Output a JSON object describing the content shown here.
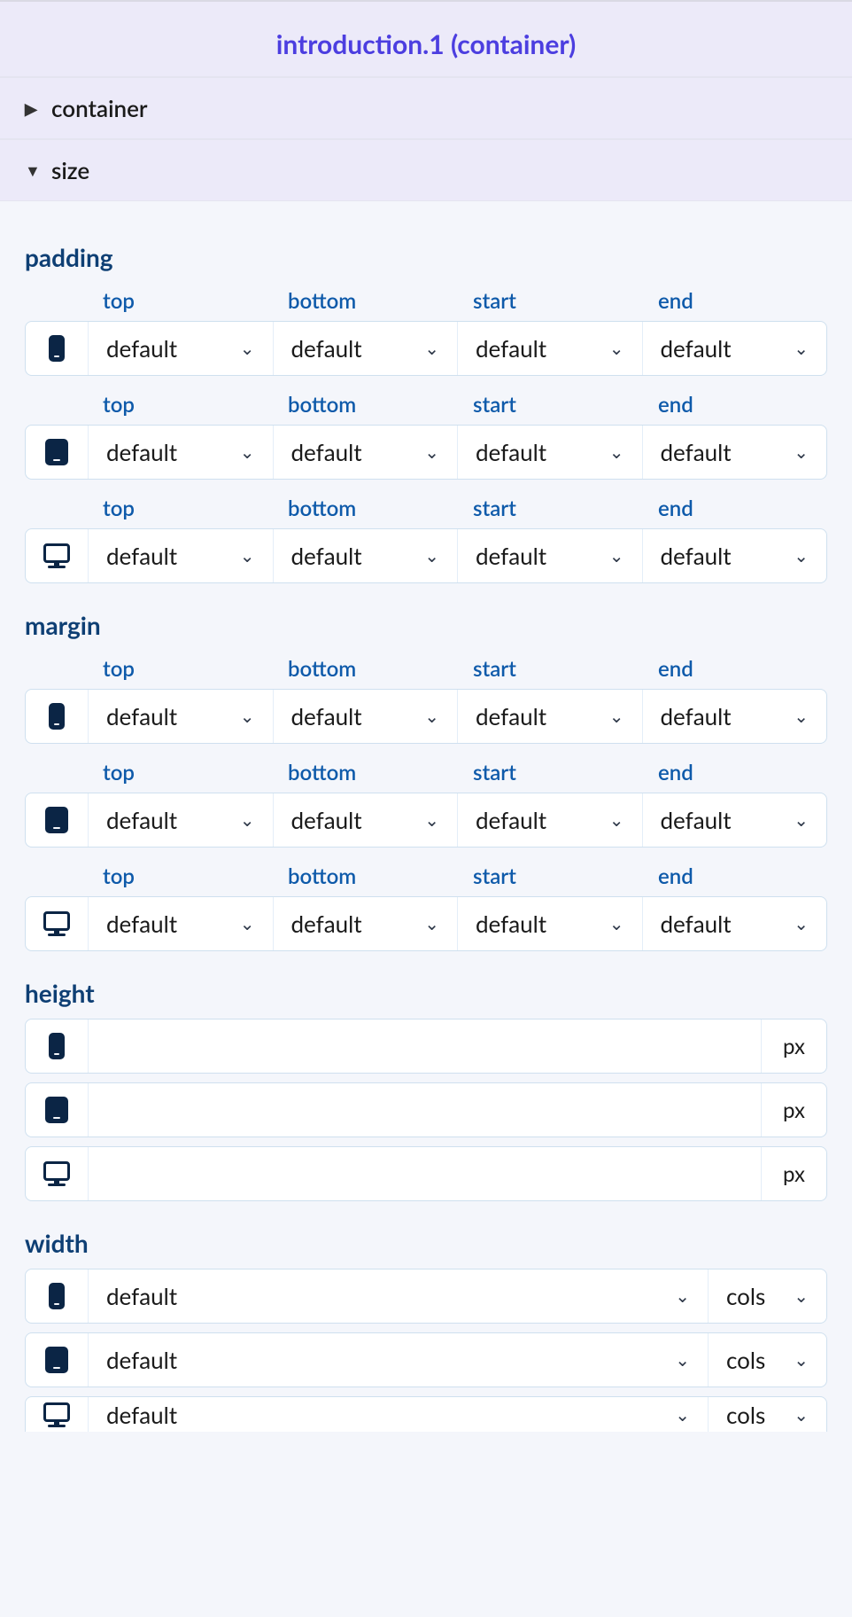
{
  "header": {
    "title": "introduction.1 (container)"
  },
  "sections": {
    "container": "container",
    "size": "size"
  },
  "labels": {
    "padding": "padding",
    "margin": "margin",
    "height": "height",
    "width": "width"
  },
  "headers": {
    "top": "top",
    "bottom": "bottom",
    "start": "start",
    "end": "end"
  },
  "values": {
    "default": "default",
    "px": "px",
    "cols": "cols"
  },
  "padding": [
    {
      "device": "mobile",
      "top": "default",
      "bottom": "default",
      "start": "default",
      "end": "default"
    },
    {
      "device": "tablet",
      "top": "default",
      "bottom": "default",
      "start": "default",
      "end": "default"
    },
    {
      "device": "desktop",
      "top": "default",
      "bottom": "default",
      "start": "default",
      "end": "default"
    }
  ],
  "margin": [
    {
      "device": "mobile",
      "top": "default",
      "bottom": "default",
      "start": "default",
      "end": "default"
    },
    {
      "device": "tablet",
      "top": "default",
      "bottom": "default",
      "start": "default",
      "end": "default"
    },
    {
      "device": "desktop",
      "top": "default",
      "bottom": "default",
      "start": "default",
      "end": "default"
    }
  ],
  "height": [
    {
      "device": "mobile",
      "value": "",
      "unit": "px"
    },
    {
      "device": "tablet",
      "value": "",
      "unit": "px"
    },
    {
      "device": "desktop",
      "value": "",
      "unit": "px"
    }
  ],
  "width": [
    {
      "device": "mobile",
      "value": "default",
      "unit": "cols"
    },
    {
      "device": "tablet",
      "value": "default",
      "unit": "cols"
    },
    {
      "device": "desktop",
      "value": "default",
      "unit": "cols"
    }
  ]
}
